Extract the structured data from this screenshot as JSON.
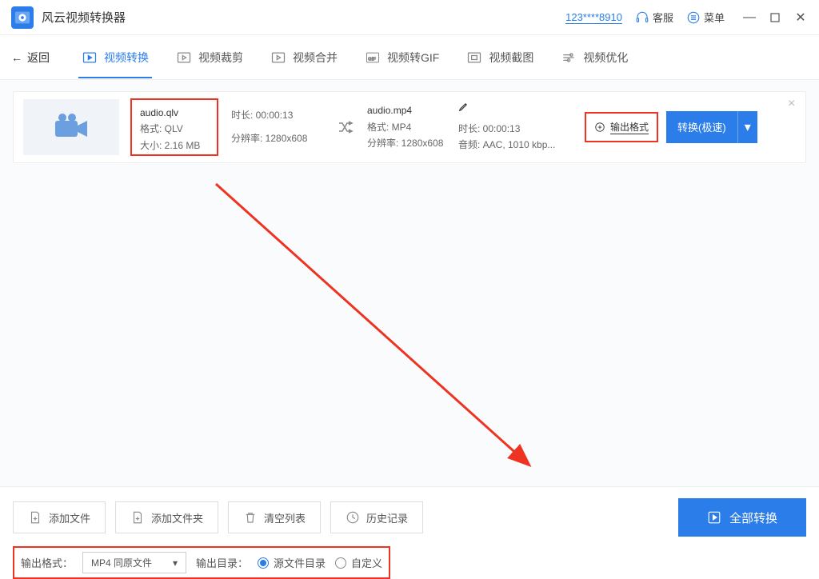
{
  "titlebar": {
    "app_name": "风云视频转换器",
    "user_id": "123****8910",
    "support": "客服",
    "menu": "菜单"
  },
  "nav": {
    "back": "返回",
    "tabs": [
      {
        "label": "视频转换",
        "active": true
      },
      {
        "label": "视频裁剪"
      },
      {
        "label": "视频合并"
      },
      {
        "label": "视频转GIF"
      },
      {
        "label": "视频截图"
      },
      {
        "label": "视频优化"
      }
    ]
  },
  "file": {
    "src_name": "audio.qlv",
    "src_format": "格式: QLV",
    "src_size": "大小: 2.16 MB",
    "duration": "时长: 00:00:13",
    "resolution": "分辨率: 1280x608",
    "out_name": "audio.mp4",
    "out_format": "格式: MP4",
    "out_resolution": "分辨率: 1280x608",
    "out_duration": "时长: 00:00:13",
    "out_audio": "音频: AAC, 1010 kbp...",
    "fmt_btn": "输出格式",
    "convert_btn": "转换(极速)"
  },
  "bottom": {
    "add_file": "添加文件",
    "add_folder": "添加文件夹",
    "clear": "清空列表",
    "history": "历史记录",
    "convert_all": "全部转换",
    "out_fmt_label": "输出格式：",
    "out_fmt_value": "MP4 同原文件",
    "out_dir_label": "输出目录：",
    "radio_src": "源文件目录",
    "radio_custom": "自定义"
  }
}
